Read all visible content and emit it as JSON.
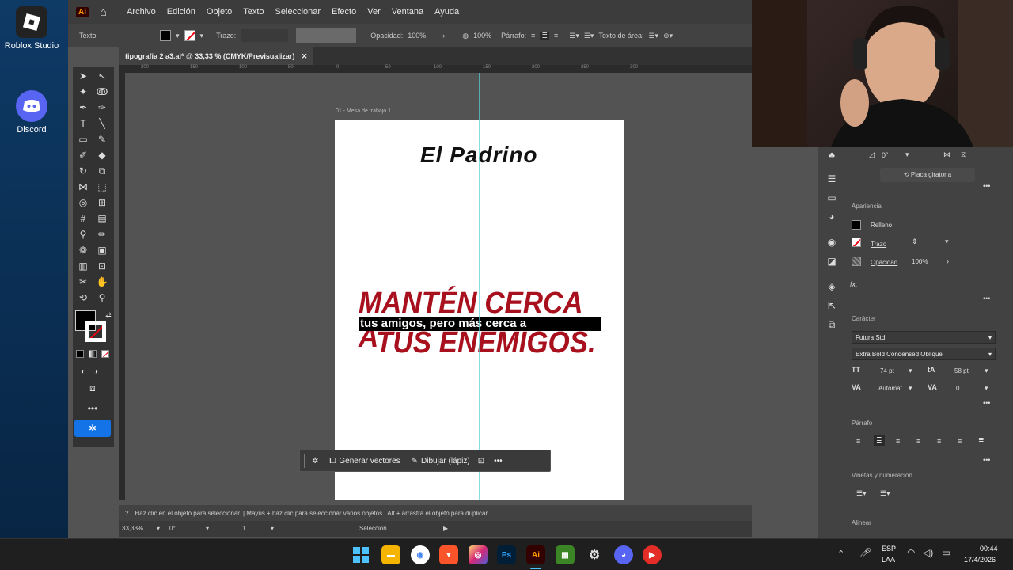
{
  "desktop": {
    "icons": [
      {
        "label": "Roblox Studio"
      },
      {
        "label": "Discord"
      }
    ]
  },
  "app": {
    "logo": "Ai",
    "menu": [
      "Archivo",
      "Edición",
      "Objeto",
      "Texto",
      "Seleccionar",
      "Efecto",
      "Ver",
      "Ventana",
      "Ayuda"
    ]
  },
  "control_bar": {
    "label": "Texto",
    "stroke_label": "Trazo:",
    "opacity_label": "Opacidad:",
    "opacity_value": "100%",
    "percent": "100%",
    "paragraph_label": "Párrafo:",
    "area_text_label": "Texto de área:"
  },
  "document": {
    "tab_title": "tipografia 2 a3.ai* @ 33,33 % (CMYK/Previsualizar)",
    "artboard_name": "01 - Mesa de trabajo 1",
    "ruler_ticks": [
      "200",
      "150",
      "100",
      "50",
      "0",
      "50",
      "100",
      "150",
      "200",
      "250",
      "300"
    ]
  },
  "artwork": {
    "title": "El Padrino",
    "line1": "MANTÉN CERCA A",
    "line2": "tus amigos,  pero más cerca a",
    "line3": "TUS ENEMIGOS.",
    "accent_color": "#a8101e"
  },
  "context_bar": {
    "generate": "Generar vectores",
    "draw": "Dibujar (lápiz)"
  },
  "status": {
    "hint": "Haz clic en el objeto para seleccionar.  |  Mayús + haz clic para seleccionar varios objetos  |  Alt + arrastra el objeto para duplicar.",
    "zoom": "33,33%",
    "rotation": "0°",
    "artboard_num": "1",
    "tool": "Selección"
  },
  "properties": {
    "rotation": "0°",
    "placa_button": "Placa giratoria",
    "appearance_title": "Apariencia",
    "fill_label": "Relleno",
    "stroke_label": "Trazo",
    "opacity_label": "Opacidad",
    "opacity_value": "100%",
    "fx": "fx.",
    "character_title": "Carácter",
    "font_family": "Futura Std",
    "font_style": "Extra Bold Condensed Oblique",
    "font_size": "74 pt",
    "leading": "58 pt",
    "kerning": "Automát",
    "tracking": "0",
    "paragraph_title": "Párrafo",
    "bullets_title": "Viñetas y numeración",
    "align_title": "Alinear"
  },
  "taskbar": {
    "lang": "ESP",
    "lang2": "LAA",
    "time": "00:44",
    "date": "17/4/2026"
  }
}
